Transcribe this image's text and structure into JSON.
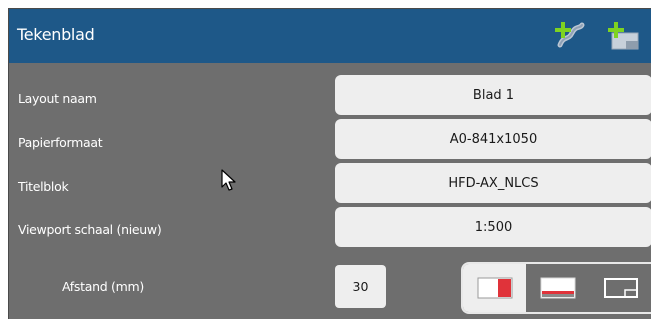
{
  "header": {
    "title": "Tekenblad",
    "actions": [
      {
        "icon": "add-viewport-icon"
      },
      {
        "icon": "add-sheet-icon"
      }
    ]
  },
  "fields": [
    {
      "label": "Layout naam",
      "value": "Blad 1"
    },
    {
      "label": "Papierformaat",
      "value": "A0-841x1050"
    },
    {
      "label": "Titelblok",
      "value": "HFD-AX_NLCS"
    },
    {
      "label": "Viewport schaal (nieuw)",
      "value": "1:500"
    }
  ],
  "spacing": {
    "label": "Afstand (mm)",
    "value": "30"
  },
  "placement_options": [
    {
      "icon": "place-right-icon",
      "selected": true
    },
    {
      "icon": "place-bottom-icon",
      "selected": false
    },
    {
      "icon": "place-none-icon",
      "selected": false
    }
  ],
  "colors": {
    "header": "#1e5888",
    "panel": "#6e6e6e",
    "field": "#eeeeee",
    "accent_green": "#7ed321",
    "accent_red": "#e0333a"
  }
}
